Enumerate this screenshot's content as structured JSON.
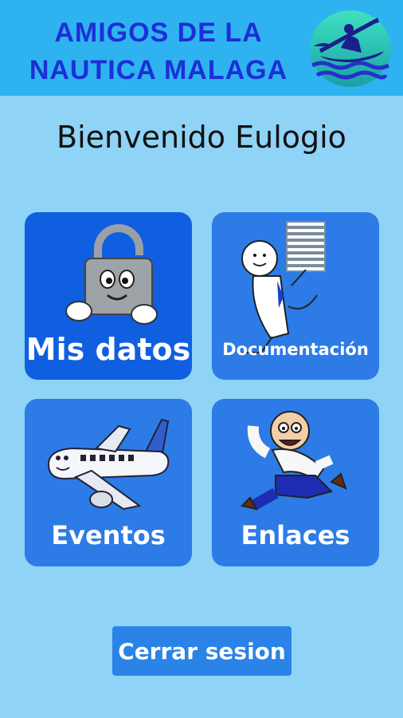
{
  "header": {
    "title_line1": "AMIGOS DE LA",
    "title_line2": "NAUTICA MALAGA",
    "logo_icon": "kayak-waves-logo"
  },
  "welcome_text": "Bienvenido Eulogio",
  "tiles": [
    {
      "label": "Mis datos",
      "icon": "padlock-mascot-icon"
    },
    {
      "label": "Documentación",
      "icon": "person-with-documents-icon"
    },
    {
      "label": "Eventos",
      "icon": "airplane-icon"
    },
    {
      "label": "Enlaces",
      "icon": "running-man-icon"
    }
  ],
  "logout_label": "Cerrar sesion",
  "colors": {
    "background": "#8fd3f6",
    "header": "#2eb3f0",
    "title": "#1d2fd6",
    "tile": "#2d7be6",
    "tile_selected": "#0f5fe0",
    "button": "#2a83e6"
  }
}
